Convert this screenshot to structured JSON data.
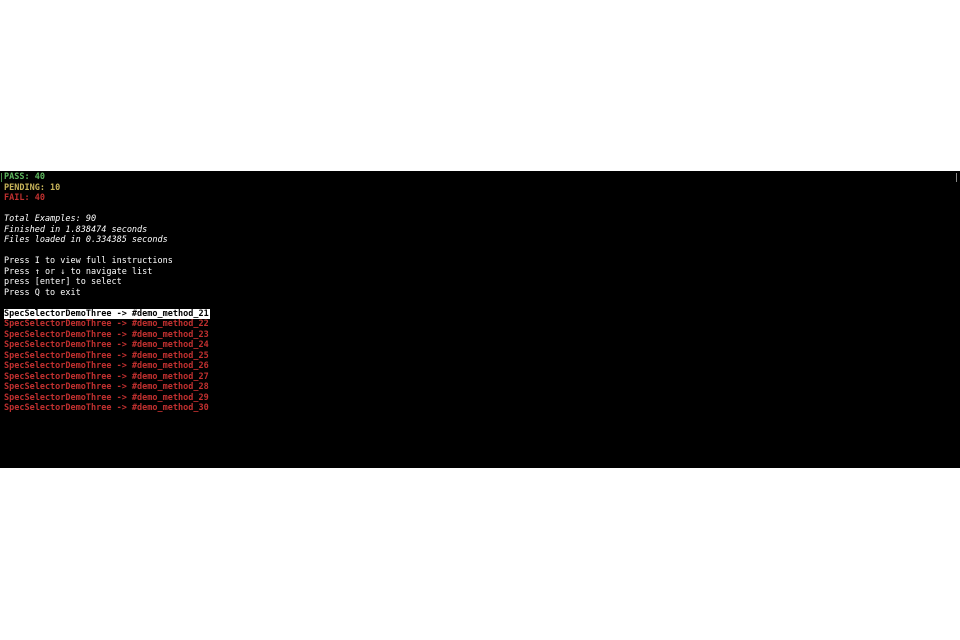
{
  "colors": {
    "pass": "#5fb85f",
    "pending": "#c8b45a",
    "fail": "#c0302f",
    "text": "#ffffff",
    "background": "#000000"
  },
  "summary": {
    "pass": "PASS: 40",
    "pending": "PENDING: 10",
    "fail": "FAIL: 40"
  },
  "stats": {
    "total": "Total Examples: 90",
    "finished": "Finished in 1.838474 seconds",
    "loaded": "Files loaded in 0.334385 seconds"
  },
  "instructions": [
    "Press I to view full instructions",
    "Press ↑ or ↓ to navigate list",
    "press [enter] to select",
    "Press Q to exit"
  ],
  "specs": [
    "SpecSelectorDemoThree -> #demo_method_21",
    "SpecSelectorDemoThree -> #demo_method_22",
    "SpecSelectorDemoThree -> #demo_method_23",
    "SpecSelectorDemoThree -> #demo_method_24",
    "SpecSelectorDemoThree -> #demo_method_25",
    "SpecSelectorDemoThree -> #demo_method_26",
    "SpecSelectorDemoThree -> #demo_method_27",
    "SpecSelectorDemoThree -> #demo_method_28",
    "SpecSelectorDemoThree -> #demo_method_29",
    "SpecSelectorDemoThree -> #demo_method_30"
  ]
}
